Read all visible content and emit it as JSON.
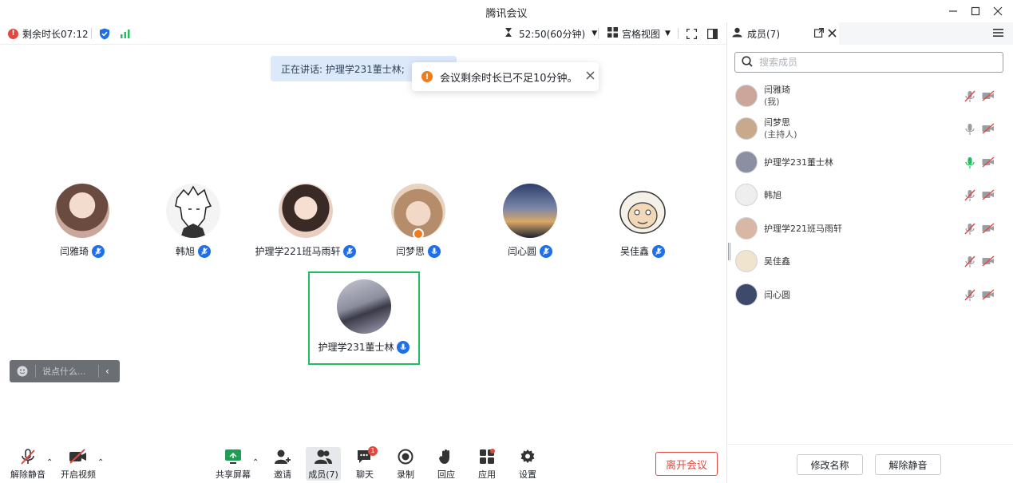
{
  "app": {
    "title": "腾讯会议"
  },
  "topbar": {
    "remaining": "剩余时长07:12",
    "timer": "52:50(60分钟)",
    "view_mode": "宫格视图"
  },
  "speaking": {
    "text": "正在讲话: 护理学231董士林;"
  },
  "toast": {
    "text": "会议剩余时长已不足10分钟。"
  },
  "participants_grid": [
    {
      "name": "闫雅琦",
      "color": "#caa79a"
    },
    {
      "name": "韩旭",
      "color": "#eeeeee"
    },
    {
      "name": "护理学221班马雨轩",
      "color": "#d9b7a5"
    },
    {
      "name": "闫梦思",
      "color": "#c9a98b"
    },
    {
      "name": "闫心圆",
      "color": "#3e4a6b"
    },
    {
      "name": "吴佳鑫",
      "color": "#f1e4cf"
    },
    {
      "name": "护理学231董士林",
      "color": "#8c8fa1"
    }
  ],
  "chat": {
    "placeholder": "说点什么..."
  },
  "toolbar": {
    "unmute": "解除静音",
    "video": "开启视频",
    "share": "共享屏幕",
    "invite": "邀请",
    "members": "成员(7)",
    "chat": "聊天",
    "record": "录制",
    "react": "回应",
    "apps": "应用",
    "settings": "设置",
    "leave": "离开会议",
    "chat_badge": "1"
  },
  "panel": {
    "tab": "成员(7)",
    "search_placeholder": "搜索成员",
    "members": [
      {
        "name": "闫雅琦",
        "sub": "(我)",
        "color": "#caa79a",
        "mic": "muted"
      },
      {
        "name": "闫梦思",
        "sub": "(主持人)",
        "color": "#c9a98b",
        "mic": "idle"
      },
      {
        "name": "护理学231董士林",
        "sub": "",
        "color": "#8c8fa1",
        "mic": "speaking"
      },
      {
        "name": "韩旭",
        "sub": "",
        "color": "#eeeeee",
        "mic": "muted"
      },
      {
        "name": "护理学221班马雨轩",
        "sub": "",
        "color": "#d9b7a5",
        "mic": "muted"
      },
      {
        "name": "吴佳鑫",
        "sub": "",
        "color": "#f1e4cf",
        "mic": "muted"
      },
      {
        "name": "闫心圆",
        "sub": "",
        "color": "#3e4a6b",
        "mic": "muted"
      }
    ],
    "rename": "修改名称",
    "unmute": "解除静音"
  },
  "colors": {
    "accent": "#1e6fe8",
    "danger": "#e2483f",
    "speaking_green": "#1fbf5f",
    "warning": "#f07c1e"
  }
}
